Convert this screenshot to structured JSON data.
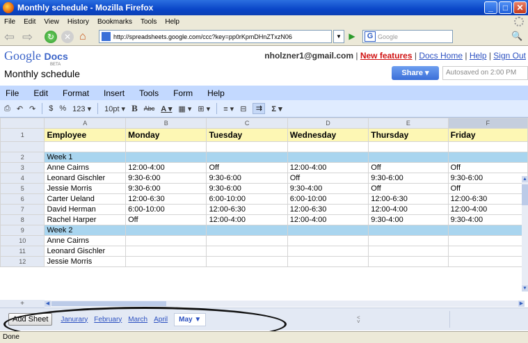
{
  "window": {
    "title": "Monthly schedule - Mozilla Firefox"
  },
  "browser_menu": [
    "File",
    "Edit",
    "View",
    "History",
    "Bookmarks",
    "Tools",
    "Help"
  ],
  "nav": {
    "url": "http://spreadsheets.google.com/ccc?key=pp0rKpmDHnZTxzN06",
    "search_placeholder": "Google"
  },
  "docs": {
    "logo_google": "Google",
    "logo_docs": "Docs",
    "logo_beta": "BETA",
    "email": "nholzner1@gmail.com",
    "new_features": "New features",
    "docs_home": "Docs Home",
    "help": "Help",
    "sign_out": "Sign Out",
    "doc_title": "Monthly schedule",
    "share_label": "Share ▾",
    "autosave": "Autosaved on 2:00 PM"
  },
  "app_menu": [
    "File",
    "Edit",
    "Format",
    "Insert",
    "Tools",
    "Form",
    "Help"
  ],
  "toolbar": {
    "currency": "$",
    "percent": "%",
    "number": "123 ▾",
    "font_size": "10pt ▾",
    "bold": "B",
    "sum": "Σ ▾"
  },
  "grid": {
    "columns": [
      "A",
      "B",
      "C",
      "D",
      "E",
      "F"
    ],
    "header": [
      "Employee",
      "Monday",
      "Tuesday",
      "Wednesday",
      "Thursday",
      "Friday"
    ],
    "rows": [
      {
        "num": "2",
        "type": "week",
        "cells": [
          "Week 1",
          "",
          "",
          "",
          "",
          ""
        ]
      },
      {
        "num": "3",
        "cells": [
          "Anne Cairns",
          "12:00-4:00",
          "Off",
          "12:00-4:00",
          "Off",
          "Off"
        ]
      },
      {
        "num": "4",
        "cells": [
          "Leonard Gischler",
          "9:30-6:00",
          "9:30-6:00",
          "Off",
          "9:30-6:00",
          "9:30-6:00"
        ]
      },
      {
        "num": "5",
        "cells": [
          "Jessie Morris",
          "9:30-6:00",
          "9:30-6:00",
          "9:30-4:00",
          "Off",
          "Off"
        ]
      },
      {
        "num": "6",
        "cells": [
          "Carter Ueland",
          "12:00-6:30",
          "6:00-10:00",
          "6:00-10:00",
          "12:00-6:30",
          "12:00-6:30"
        ]
      },
      {
        "num": "7",
        "cells": [
          "David Herman",
          "6:00-10:00",
          "12:00-6:30",
          "12:00-6:30",
          "12:00-4:00",
          "12:00-4:00"
        ]
      },
      {
        "num": "8",
        "cells": [
          "Rachel Harper",
          "Off",
          "12:00-4:00",
          "12:00-4:00",
          "9:30-4:00",
          "9:30-4:00"
        ]
      },
      {
        "num": "9",
        "type": "week",
        "cells": [
          "Week 2",
          "",
          "",
          "",
          "",
          ""
        ]
      },
      {
        "num": "10",
        "cells": [
          "Anne Cairns",
          "",
          "",
          "",
          "",
          ""
        ]
      },
      {
        "num": "11",
        "cells": [
          "Leonard Gischler",
          "",
          "",
          "",
          "",
          ""
        ]
      },
      {
        "num": "12",
        "cells": [
          "Jessie Morris",
          "",
          "",
          "",
          "",
          ""
        ]
      }
    ],
    "add_row": "+"
  },
  "sheets": {
    "add_label": "Add Sheet",
    "tabs": [
      "Janurary",
      "February",
      "March",
      "April"
    ],
    "active": "May ▼"
  },
  "status": "Done"
}
